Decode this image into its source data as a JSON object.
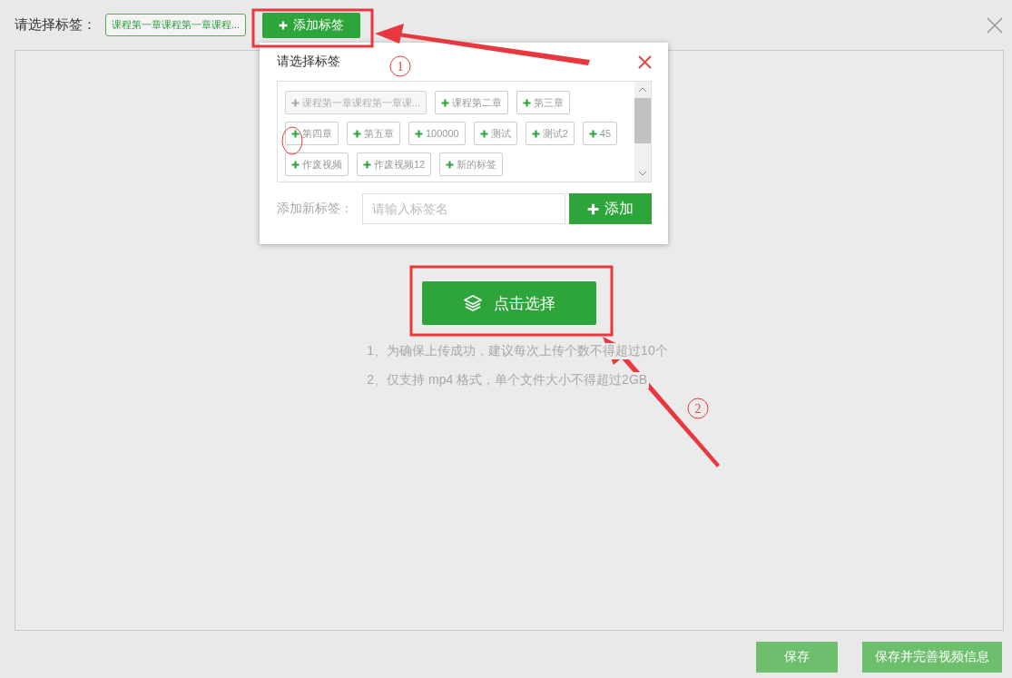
{
  "header": {
    "label": "请选择标签：",
    "selected_tag": "课程第一章课程第一章课程...",
    "add_button": "添加标签"
  },
  "tag_popup": {
    "title": "请选择标签",
    "tags": [
      {
        "label": "课程第一章课程第一章课...",
        "selected": true
      },
      {
        "label": "课程第二章",
        "selected": false
      },
      {
        "label": "第三章",
        "selected": false
      },
      {
        "label": "第四章",
        "selected": false
      },
      {
        "label": "第五章",
        "selected": false
      },
      {
        "label": "100000",
        "selected": false
      },
      {
        "label": "测试",
        "selected": false
      },
      {
        "label": "测试2",
        "selected": false
      },
      {
        "label": "45",
        "selected": false
      },
      {
        "label": "作废视频",
        "selected": false
      },
      {
        "label": "作废视频12",
        "selected": false
      },
      {
        "label": "新的标签",
        "selected": false
      }
    ],
    "new_tag_label": "添加新标签：",
    "placeholder": "请输入标签名",
    "add_button": "添加"
  },
  "upload": {
    "button": "点击选择",
    "notes": [
      "1、为确保上传成功，建议每次上传个数不得超过10个",
      "2、仅支持 mp4 格式，单个文件大小不得超过2GB"
    ]
  },
  "footer": {
    "buttons": [
      "保存",
      "保存并完善视频信息"
    ]
  },
  "callouts": [
    {
      "number": "1"
    },
    {
      "number": "2"
    }
  ]
}
